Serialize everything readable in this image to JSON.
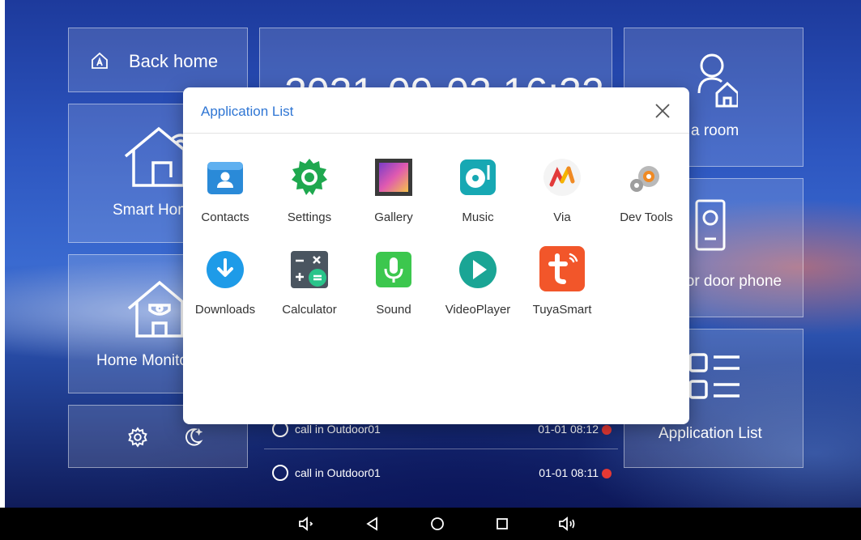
{
  "tiles": {
    "back_home": "Back home",
    "date_time": "2021-09-02 16:32",
    "call_room": "Call a room",
    "smart_home": "Smart Home",
    "door_phone": "Outdoor door phone",
    "home_monitor": "Home Monitor",
    "application_list": "Application List"
  },
  "records": [
    {
      "text": "call in Outdoor01",
      "time": "01-01 08:12"
    },
    {
      "text": "call in Outdoor01",
      "time": "01-01 08:11"
    }
  ],
  "dialog": {
    "title": "Application List",
    "apps": [
      {
        "label": "Contacts",
        "icon": "contacts-icon"
      },
      {
        "label": "Settings",
        "icon": "settings-icon"
      },
      {
        "label": "Gallery",
        "icon": "gallery-icon"
      },
      {
        "label": "Music",
        "icon": "music-icon"
      },
      {
        "label": "Via",
        "icon": "via-icon"
      },
      {
        "label": "Dev Tools",
        "icon": "dev-tools-icon"
      },
      {
        "label": "Downloads",
        "icon": "downloads-icon"
      },
      {
        "label": "Calculator",
        "icon": "calculator-icon"
      },
      {
        "label": "Sound",
        "icon": "sound-recorder-icon"
      },
      {
        "label": "VideoPlayer",
        "icon": "video-player-icon"
      },
      {
        "label": "TuyaSmart",
        "icon": "tuya-smart-icon"
      }
    ]
  },
  "colors": {
    "title_blue": "#2f76d4",
    "contacts": "#2a8ad8",
    "settings": "#1fa84f",
    "music": "#17a8b3",
    "downloads": "#1e9be8",
    "sound": "#3cc74e",
    "video": "#1aa595",
    "tuya": "#f2562a"
  }
}
